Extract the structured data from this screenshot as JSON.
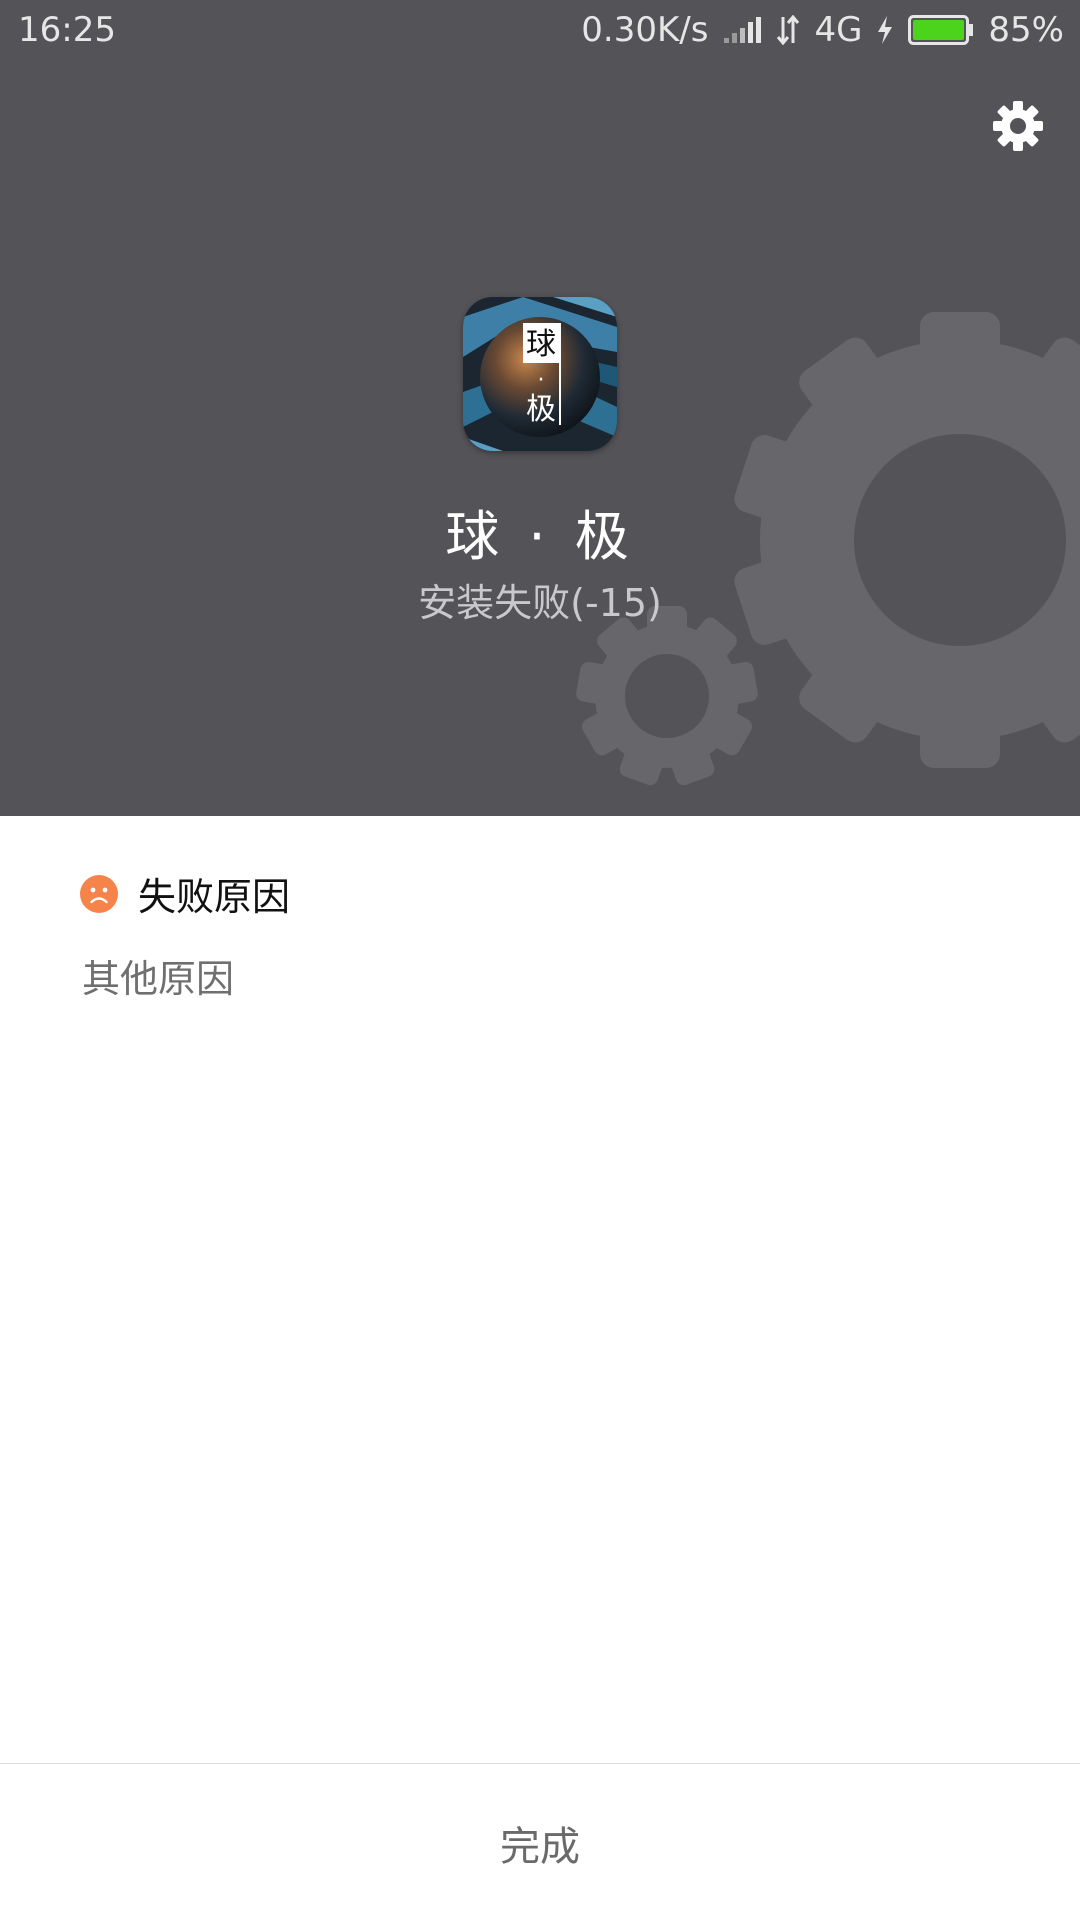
{
  "status_bar": {
    "time": "16:25",
    "network_speed": "0.30K/s",
    "network_type": "4G",
    "battery": "85%",
    "icons": [
      "signal-icon",
      "data-arrows-icon",
      "charging-icon",
      "battery-icon"
    ],
    "battery_color": "#4cd41c"
  },
  "header": {
    "background_color": "#545358",
    "settings_icon": "gear-icon",
    "app_icon_chars": [
      "球",
      "·",
      "极"
    ],
    "app_name": "球 · 极",
    "status": "安装失败(-15)"
  },
  "failure": {
    "icon": "sad-face-icon",
    "icon_color": "#f5834a",
    "title": "失败原因",
    "reason": "其他原因"
  },
  "footer": {
    "done_label": "完成"
  }
}
